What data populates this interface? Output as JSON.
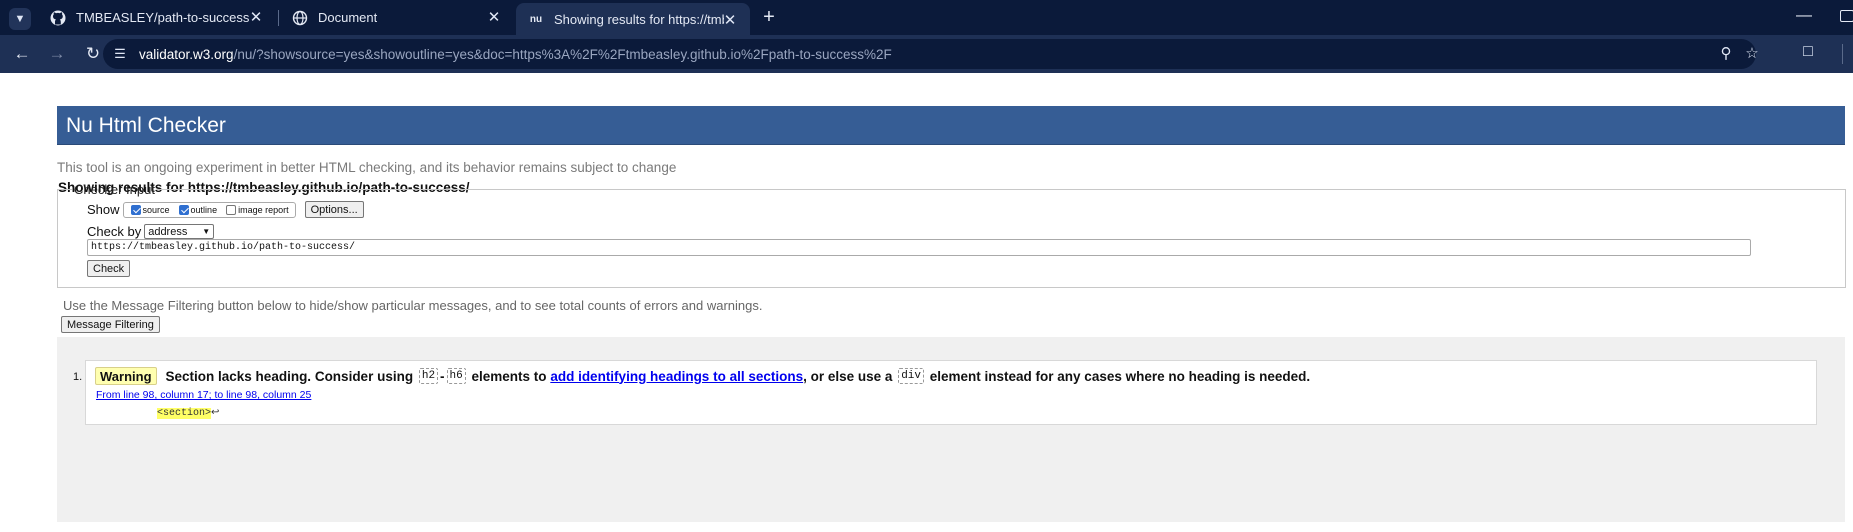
{
  "browser": {
    "tabs": [
      {
        "title": "TMBEASLEY/path-to-success",
        "icon": "github-icon",
        "active": false
      },
      {
        "title": "Document",
        "icon": "globe-icon",
        "active": false
      },
      {
        "title": "Showing results for https://tmbeasley.github.io/path-to-success/",
        "icon": "nu-icon",
        "favicon_text": "nu",
        "active": true
      }
    ],
    "url": {
      "host": "validator.w3.org",
      "path": "/nu/?showsource=yes&showoutline=yes&doc=https%3A%2F%2Ftmbeasley.github.io%2Fpath-to-success%2F"
    }
  },
  "page": {
    "header_title": "Nu Html Checker",
    "tagline": "This tool is an ongoing experiment in better HTML checking, and its behavior remains subject to change",
    "results_for": "Showing results for https://tmbeasley.github.io/path-to-success/",
    "checker_input": {
      "legend": "Checker Input",
      "show_label": "Show",
      "options": [
        {
          "label": "source",
          "checked": true
        },
        {
          "label": "outline",
          "checked": true
        },
        {
          "label": "image report",
          "checked": false
        }
      ],
      "options_button": "Options...",
      "check_by_label": "Check by",
      "check_by_value": "address",
      "address_value": "https://tmbeasley.github.io/path-to-success/",
      "check_button": "Check"
    },
    "filter_note": "Use the Message Filtering button below to hide/show particular messages, and to see total counts of errors and warnings.",
    "filter_button": "Message Filtering",
    "messages": [
      {
        "number": "1.",
        "type": "Warning",
        "text_1": "Section lacks heading. Consider using",
        "code_1": "h2",
        "dash": "-",
        "code_2": "h6",
        "text_2": "elements to",
        "link": "add identifying headings to all sections",
        "text_3": ", or else use a",
        "code_3": "div",
        "text_4": "element instead for any cases where no heading is needed.",
        "location": "From line 98, column 17; to line 98, column 25",
        "extract": "<section>",
        "extract_tail": "↩"
      }
    ]
  }
}
